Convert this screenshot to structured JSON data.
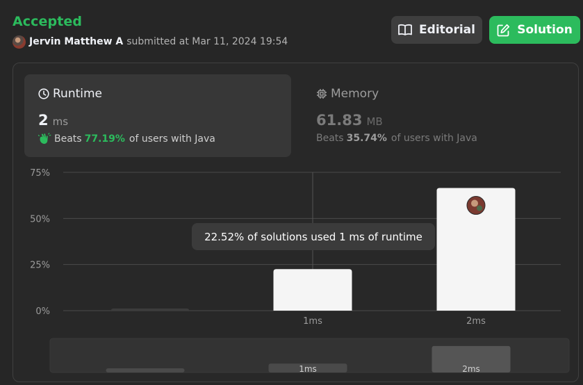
{
  "header": {
    "status": "Accepted",
    "user_name": "Jervin Matthew A",
    "submitted_text": "submitted at Mar 11, 2024 19:54",
    "editorial_label": "Editorial",
    "solution_label": "Solution"
  },
  "runtime_card": {
    "title": "Runtime",
    "value": "2",
    "unit": "ms",
    "beats_label": "Beats",
    "beats_pct": "77.19%",
    "beats_suffix": "of users with Java"
  },
  "memory_card": {
    "title": "Memory",
    "value": "61.83",
    "unit": "MB",
    "beats_label": "Beats",
    "beats_pct": "35.74%",
    "beats_suffix": "of users with Java"
  },
  "tooltip": "22.52% of solutions used 1 ms of runtime",
  "colors": {
    "accent_green": "#2cbb5d",
    "bar": "#f5f5f5",
    "bar_dim": "#3c3c3c",
    "grid": "#4a4a4a"
  },
  "icons": {
    "editorial": "book-icon",
    "solution": "edit-icon",
    "runtime": "clock-icon",
    "memory": "chip-icon",
    "beats": "clap-icon"
  },
  "chart_data": {
    "type": "bar",
    "categories": [
      "",
      "1ms",
      "2ms"
    ],
    "values": [
      1.2,
      22.52,
      66.5
    ],
    "y_ticks": [
      "75%",
      "50%",
      "25%",
      "0%"
    ],
    "y_tick_values": [
      75,
      50,
      25,
      0
    ],
    "ylim": [
      0,
      75
    ],
    "xlabel": "",
    "ylabel": "",
    "grid": true,
    "highlight_index": 2,
    "hover_index": 1,
    "navigator_labels": [
      "",
      "1ms",
      "2ms"
    ]
  }
}
